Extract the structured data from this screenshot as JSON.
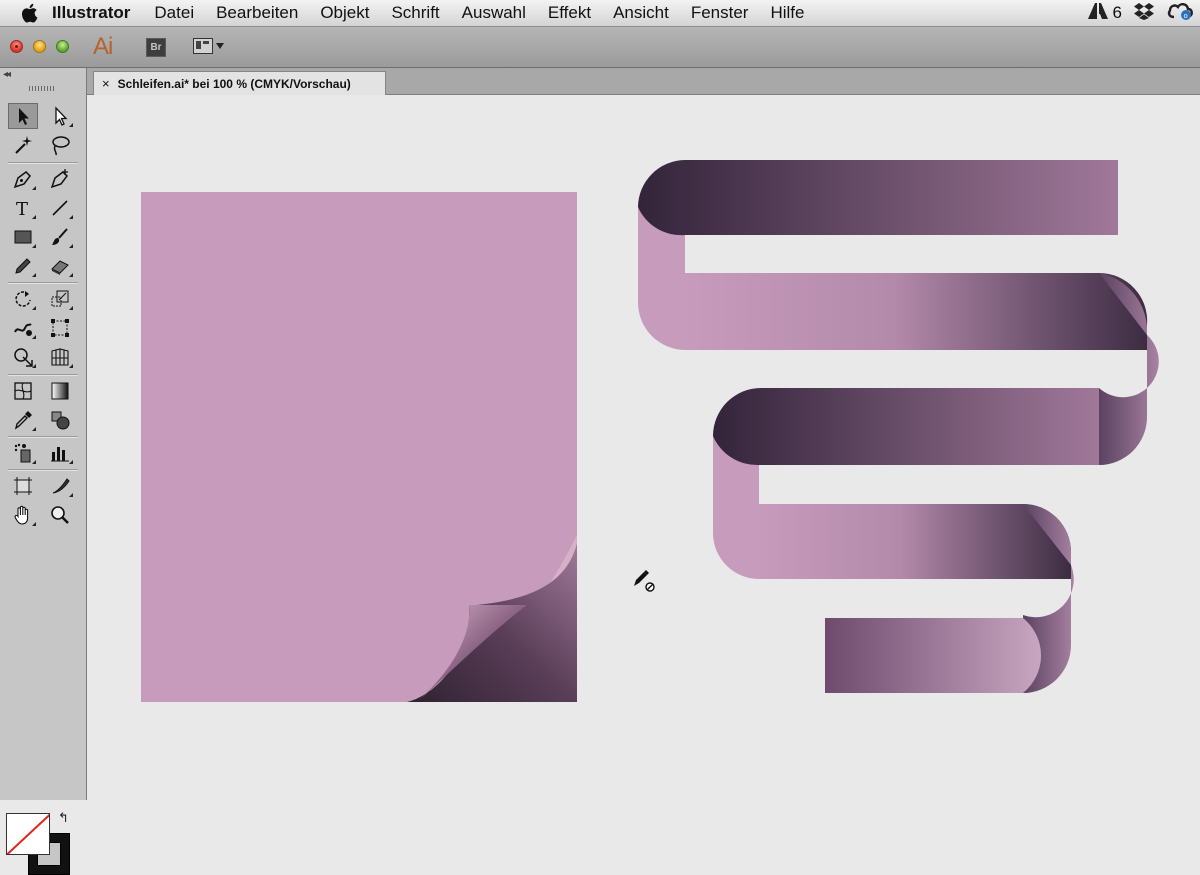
{
  "menubar": {
    "app_name": "Illustrator",
    "items": [
      {
        "label": "Datei"
      },
      {
        "label": "Bearbeiten"
      },
      {
        "label": "Objekt"
      },
      {
        "label": "Schrift"
      },
      {
        "label": "Auswahl"
      },
      {
        "label": "Effekt"
      },
      {
        "label": "Ansicht"
      },
      {
        "label": "Fenster"
      },
      {
        "label": "Hilfe"
      }
    ],
    "extras": {
      "adobe_count": "6"
    }
  },
  "appbar": {
    "logo_text": "Ai",
    "bridge_label": "Br"
  },
  "document": {
    "tab_title": "Schleifen.ai* bei 100 % (CMYK/Vorschau)",
    "close_glyph": "×"
  },
  "tools": [
    {
      "name": "selection-tool",
      "selected": true
    },
    {
      "name": "direct-selection-tool"
    },
    {
      "name": "magic-wand-tool"
    },
    {
      "name": "lasso-tool"
    },
    {
      "name": "pen-tool"
    },
    {
      "name": "curvature-pen-tool"
    },
    {
      "name": "type-tool"
    },
    {
      "name": "line-segment-tool"
    },
    {
      "name": "rectangle-tool"
    },
    {
      "name": "paintbrush-tool"
    },
    {
      "name": "pencil-tool"
    },
    {
      "name": "eraser-tool"
    },
    {
      "name": "rotate-tool"
    },
    {
      "name": "scale-tool"
    },
    {
      "name": "warp-tool"
    },
    {
      "name": "free-transform-tool"
    },
    {
      "name": "shape-builder-tool"
    },
    {
      "name": "perspective-grid-tool"
    },
    {
      "name": "mesh-tool"
    },
    {
      "name": "gradient-tool"
    },
    {
      "name": "eyedropper-tool"
    },
    {
      "name": "blend-tool"
    },
    {
      "name": "symbol-sprayer-tool"
    },
    {
      "name": "column-graph-tool"
    },
    {
      "name": "artboard-tool"
    },
    {
      "name": "slice-tool"
    },
    {
      "name": "hand-tool"
    },
    {
      "name": "zoom-tool"
    }
  ],
  "colors": {
    "ribbon_light": "#c69bbb",
    "ribbon_dark": "#3a2a3c",
    "ribbon_mid": "#9c7295",
    "app_accent": "#b7632e",
    "fill_none_slash": "#e0261a"
  }
}
